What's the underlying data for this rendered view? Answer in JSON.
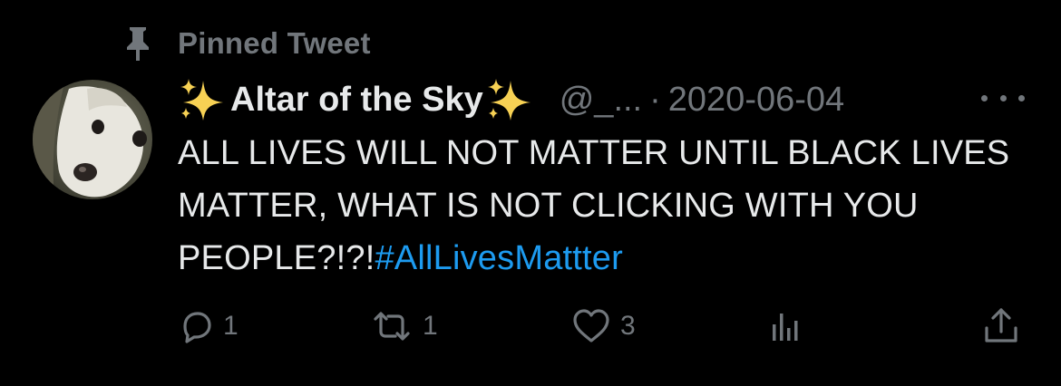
{
  "pinned": {
    "label": "Pinned Tweet"
  },
  "tweet": {
    "display_name": "Altar of the Sky",
    "handle": "@_...",
    "separator": "·",
    "date": "2020-06-04",
    "text": "ALL LIVES WILL NOT MATTER UNTIL BLACK LIVES MATTER, WHAT IS NOT CLICKING WITH YOU PEOPLE?!?!",
    "hashtag": "#AllLivesMattter"
  },
  "actions": {
    "reply_count": "1",
    "retweet_count": "1",
    "like_count": "3"
  },
  "icons": {
    "pin": "pin-icon",
    "sparkles": "sparkles-icon",
    "more": "more-icon",
    "reply": "reply-icon",
    "retweet": "retweet-icon",
    "like": "heart-icon",
    "analytics": "analytics-icon",
    "share": "share-icon"
  },
  "colors": {
    "background": "#000000",
    "text": "#e7e9ea",
    "muted": "#71767b",
    "link": "#1d9bf0",
    "sparkle": "#f7d154"
  }
}
